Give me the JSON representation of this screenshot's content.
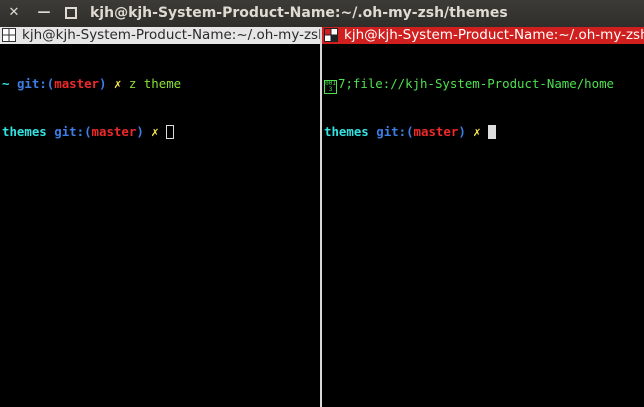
{
  "window": {
    "title": "kjh@kjh-System-Product-Name:~/.oh-my-zsh/themes",
    "close_glyph": "✕",
    "min_glyph": "—"
  },
  "left_pane": {
    "tab_title": "kjh@kjh-System-Product-Name:~/.oh-my-zsh",
    "lines": [
      {
        "dir": "~",
        "git_label": "git:",
        "paren_open": "(",
        "branch": "master",
        "paren_close": ")",
        "dirty": "✗",
        "command": "z theme"
      },
      {
        "dir": "themes",
        "git_label": "git:",
        "paren_open": "(",
        "branch": "master",
        "paren_close": ")",
        "dirty": "✗"
      }
    ]
  },
  "right_pane": {
    "tab_title": "kjh@kjh-System-Product-Name:~/.oh-my-zsh",
    "escape_box": "0013",
    "escape_output": "7;file://kjh-System-Product-Name/home",
    "prompt": {
      "dir": "themes",
      "git_label": "git:",
      "paren_open": "(",
      "branch": "master",
      "paren_close": ")",
      "dirty": "✗"
    }
  },
  "colors": {
    "active_tab": "#d01f1f",
    "inactive_tab": "#e6e6e6",
    "dir": "#34e2e2",
    "git": "#3b7ee6",
    "branch": "#ef2929",
    "dirty": "#fce94f",
    "command": "#8ae234"
  }
}
